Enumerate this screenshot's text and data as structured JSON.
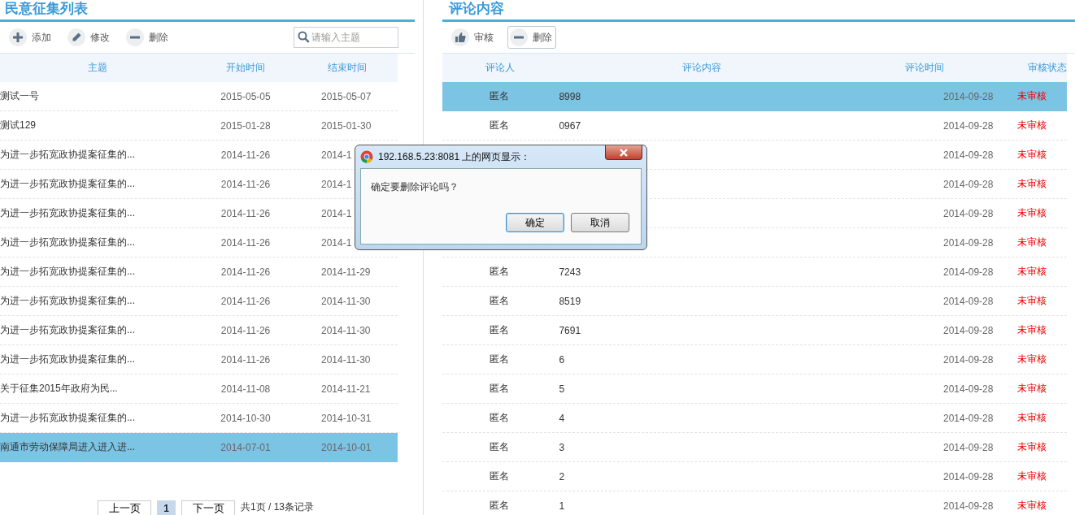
{
  "left_panel": {
    "title": "民意征集列表",
    "toolbar": [
      {
        "kind": "add",
        "label": "添加"
      },
      {
        "kind": "edit",
        "label": "修改"
      },
      {
        "kind": "delete",
        "label": "删除"
      }
    ],
    "search": {
      "placeholder": "请输入主题"
    },
    "columns": [
      "主题",
      "开始时间",
      "结束时间"
    ],
    "rows": [
      {
        "subject": "测试一号",
        "start": "2015-05-05",
        "end": "2015-05-07",
        "selected": false
      },
      {
        "subject": "测试129",
        "start": "2015-01-28",
        "end": "2015-01-30",
        "selected": false
      },
      {
        "subject": "为进一步拓宽政协提案征集的...",
        "start": "2014-11-26",
        "end": "2014-1",
        "selected": false
      },
      {
        "subject": "为进一步拓宽政协提案征集的...",
        "start": "2014-11-26",
        "end": "2014-1",
        "selected": false
      },
      {
        "subject": "为进一步拓宽政协提案征集的...",
        "start": "2014-11-26",
        "end": "2014-1",
        "selected": false
      },
      {
        "subject": "为进一步拓宽政协提案征集的...",
        "start": "2014-11-26",
        "end": "2014-1",
        "selected": false
      },
      {
        "subject": "为进一步拓宽政协提案征集的...",
        "start": "2014-11-26",
        "end": "2014-11-29",
        "selected": false
      },
      {
        "subject": "为进一步拓宽政协提案征集的...",
        "start": "2014-11-26",
        "end": "2014-11-30",
        "selected": false
      },
      {
        "subject": "为进一步拓宽政协提案征集的...",
        "start": "2014-11-26",
        "end": "2014-11-30",
        "selected": false
      },
      {
        "subject": "为进一步拓宽政协提案征集的...",
        "start": "2014-11-26",
        "end": "2014-11-30",
        "selected": false
      },
      {
        "subject": "关于征集2015年政府为民...",
        "start": "2014-11-08",
        "end": "2014-11-21",
        "selected": false
      },
      {
        "subject": "为进一步拓宽政协提案征集的...",
        "start": "2014-10-30",
        "end": "2014-10-31",
        "selected": false
      },
      {
        "subject": "南通市劳动保障局进入进入进...",
        "start": "2014-07-01",
        "end": "2014-10-01",
        "selected": true
      }
    ],
    "pagination": {
      "prev": "上一页",
      "pages": [
        {
          "label": "1",
          "selected": true
        }
      ],
      "next": "下一页",
      "summary": "共1页 / 13条记录"
    }
  },
  "right_panel": {
    "title": "评论内容",
    "toolbar": [
      {
        "kind": "approve",
        "label": "审核"
      },
      {
        "kind": "delete",
        "label": "删除"
      }
    ],
    "columns": [
      "评论人",
      "评论内容",
      "评论时间",
      "审核状态"
    ],
    "rows": [
      {
        "reviewer": "匿名",
        "content": "8998",
        "time": "2014-09-28",
        "status": "未审核",
        "selected": true
      },
      {
        "reviewer": "匿名",
        "content": "0967",
        "time": "2014-09-28",
        "status": "未审核",
        "selected": false
      },
      {
        "time": "2014-09-28",
        "status": "未审核",
        "selected": false
      },
      {
        "time": "2014-09-28",
        "status": "未审核",
        "selected": false
      },
      {
        "time": "2014-09-28",
        "status": "未审核",
        "selected": false
      },
      {
        "time": "2014-09-28",
        "status": "未审核",
        "selected": false
      },
      {
        "reviewer": "匿名",
        "content": "7243",
        "time": "2014-09-28",
        "status": "未审核",
        "selected": false
      },
      {
        "reviewer": "匿名",
        "content": "8519",
        "time": "2014-09-28",
        "status": "未审核",
        "selected": false
      },
      {
        "reviewer": "匿名",
        "content": "7691",
        "time": "2014-09-28",
        "status": "未审核",
        "selected": false
      },
      {
        "reviewer": "匿名",
        "content": "6",
        "time": "2014-09-28",
        "status": "未审核",
        "selected": false
      },
      {
        "reviewer": "匿名",
        "content": "5",
        "time": "2014-09-28",
        "status": "未审核",
        "selected": false
      },
      {
        "reviewer": "匿名",
        "content": "4",
        "time": "2014-09-28",
        "status": "未审核",
        "selected": false
      },
      {
        "reviewer": "匿名",
        "content": "3",
        "time": "2014-09-28",
        "status": "未审核",
        "selected": false
      },
      {
        "reviewer": "匿名",
        "content": "2",
        "time": "2014-09-28",
        "status": "未审核",
        "selected": false
      },
      {
        "reviewer": "匿名",
        "content": "1",
        "time": "2014-09-28",
        "status": "未审核",
        "selected": false
      }
    ]
  },
  "dialog": {
    "title": "192.168.5.23:8081 上的网页显示：",
    "message": "确定要删除评论吗？",
    "buttons": [
      {
        "label": "确定",
        "selected": true
      },
      {
        "label": "取消",
        "selected": false
      }
    ]
  }
}
